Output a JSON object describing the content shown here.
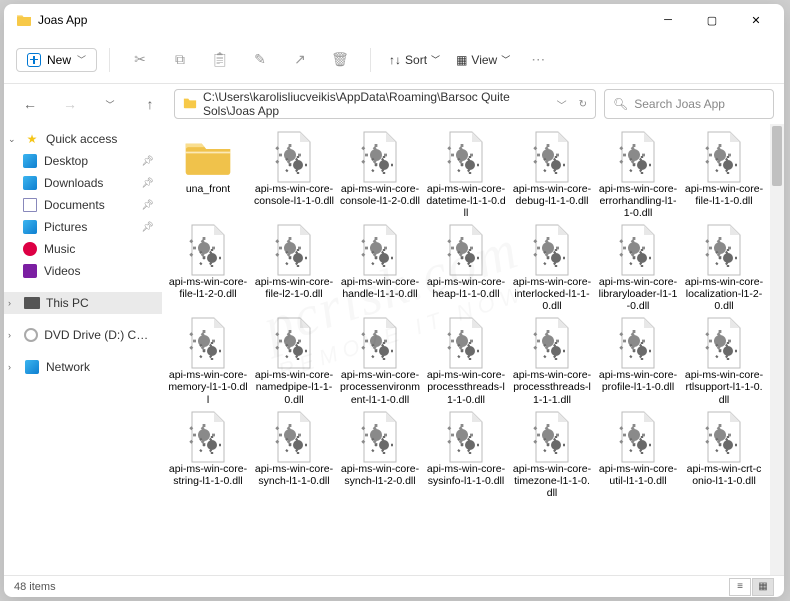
{
  "window": {
    "title": "Joas App"
  },
  "ribbon": {
    "new_label": "New",
    "sort_label": "Sort",
    "view_label": "View"
  },
  "nav": {
    "path": "C:\\Users\\karolisliucveikis\\AppData\\Roaming\\Barsoc Quite Sols\\Joas App",
    "search_placeholder": "Search Joas App"
  },
  "sidebar": {
    "quick": "Quick access",
    "items": [
      {
        "label": "Desktop",
        "pin": true
      },
      {
        "label": "Downloads",
        "pin": true
      },
      {
        "label": "Documents",
        "pin": true
      },
      {
        "label": "Pictures",
        "pin": true
      },
      {
        "label": "Music",
        "pin": false
      },
      {
        "label": "Videos",
        "pin": false
      }
    ],
    "thispc": "This PC",
    "dvd": "DVD Drive (D:) CCCC",
    "network": "Network"
  },
  "files": [
    {
      "type": "folder",
      "name": "una_front"
    },
    {
      "type": "dll",
      "name": "api-ms-win-core-console-l1-1-0.dll"
    },
    {
      "type": "dll",
      "name": "api-ms-win-core-console-l1-2-0.dll"
    },
    {
      "type": "dll",
      "name": "api-ms-win-core-datetime-l1-1-0.dll"
    },
    {
      "type": "dll",
      "name": "api-ms-win-core-debug-l1-1-0.dll"
    },
    {
      "type": "dll",
      "name": "api-ms-win-core-errorhandling-l1-1-0.dll"
    },
    {
      "type": "dll",
      "name": "api-ms-win-core-file-l1-1-0.dll"
    },
    {
      "type": "dll",
      "name": "api-ms-win-core-file-l1-2-0.dll"
    },
    {
      "type": "dll",
      "name": "api-ms-win-core-file-l2-1-0.dll"
    },
    {
      "type": "dll",
      "name": "api-ms-win-core-handle-l1-1-0.dll"
    },
    {
      "type": "dll",
      "name": "api-ms-win-core-heap-l1-1-0.dll"
    },
    {
      "type": "dll",
      "name": "api-ms-win-core-interlocked-l1-1-0.dll"
    },
    {
      "type": "dll",
      "name": "api-ms-win-core-libraryloader-l1-1-0.dll"
    },
    {
      "type": "dll",
      "name": "api-ms-win-core-localization-l1-2-0.dll"
    },
    {
      "type": "dll",
      "name": "api-ms-win-core-memory-l1-1-0.dll"
    },
    {
      "type": "dll",
      "name": "api-ms-win-core-namedpipe-l1-1-0.dll"
    },
    {
      "type": "dll",
      "name": "api-ms-win-core-processenvironment-l1-1-0.dll"
    },
    {
      "type": "dll",
      "name": "api-ms-win-core-processthreads-l1-1-0.dll"
    },
    {
      "type": "dll",
      "name": "api-ms-win-core-processthreads-l1-1-1.dll"
    },
    {
      "type": "dll",
      "name": "api-ms-win-core-profile-l1-1-0.dll"
    },
    {
      "type": "dll",
      "name": "api-ms-win-core-rtlsupport-l1-1-0.dll"
    },
    {
      "type": "dll",
      "name": "api-ms-win-core-string-l1-1-0.dll"
    },
    {
      "type": "dll",
      "name": "api-ms-win-core-synch-l1-1-0.dll"
    },
    {
      "type": "dll",
      "name": "api-ms-win-core-synch-l1-2-0.dll"
    },
    {
      "type": "dll",
      "name": "api-ms-win-core-sysinfo-l1-1-0.dll"
    },
    {
      "type": "dll",
      "name": "api-ms-win-core-timezone-l1-1-0.dll"
    },
    {
      "type": "dll",
      "name": "api-ms-win-core-util-l1-1-0.dll"
    },
    {
      "type": "dll",
      "name": "api-ms-win-crt-conio-l1-1-0.dll"
    }
  ],
  "status": {
    "count": "48 items"
  }
}
